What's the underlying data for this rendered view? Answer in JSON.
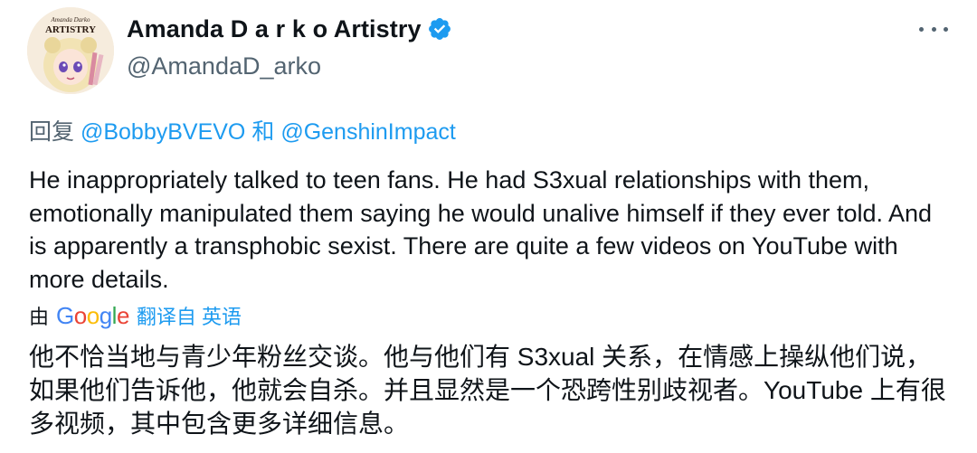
{
  "author": {
    "display_name": "Amanda D a r k o Artistry",
    "handle": "@AmandaD_arko",
    "verified": true,
    "avatar_text_top": "Amanda Darko",
    "avatar_text_main": "ARTISTRY"
  },
  "reply": {
    "prefix": "回复",
    "mention_1": "@BobbyBVEVO",
    "conjunction": "和",
    "mention_2": "@GenshinImpact"
  },
  "tweet": {
    "text": "He inappropriately talked to teen fans. He had S3xual relationships with them, emotionally manipulated them saying he would unalive himself if they ever told. And is apparently a transphobic sexist. There are quite a few videos on YouTube with more details."
  },
  "translation": {
    "by_label": "由",
    "provider": "Google",
    "link_label": "翻译自 英语",
    "text": "他不恰当地与青少年粉丝交谈。他与他们有 S3xual 关系，在情感上操纵他们说，如果他们告诉他，他就会自杀。并且显然是一个恐跨性别歧视者。YouTube 上有很多视频，其中包含更多详细信息。"
  },
  "colors": {
    "text_primary": "#0f1419",
    "text_secondary": "#536471",
    "link": "#1d9bf0",
    "verified_badge": "#1d9bf0"
  },
  "icons": {
    "verified": "verified-badge-icon",
    "more": "more-options-icon"
  }
}
